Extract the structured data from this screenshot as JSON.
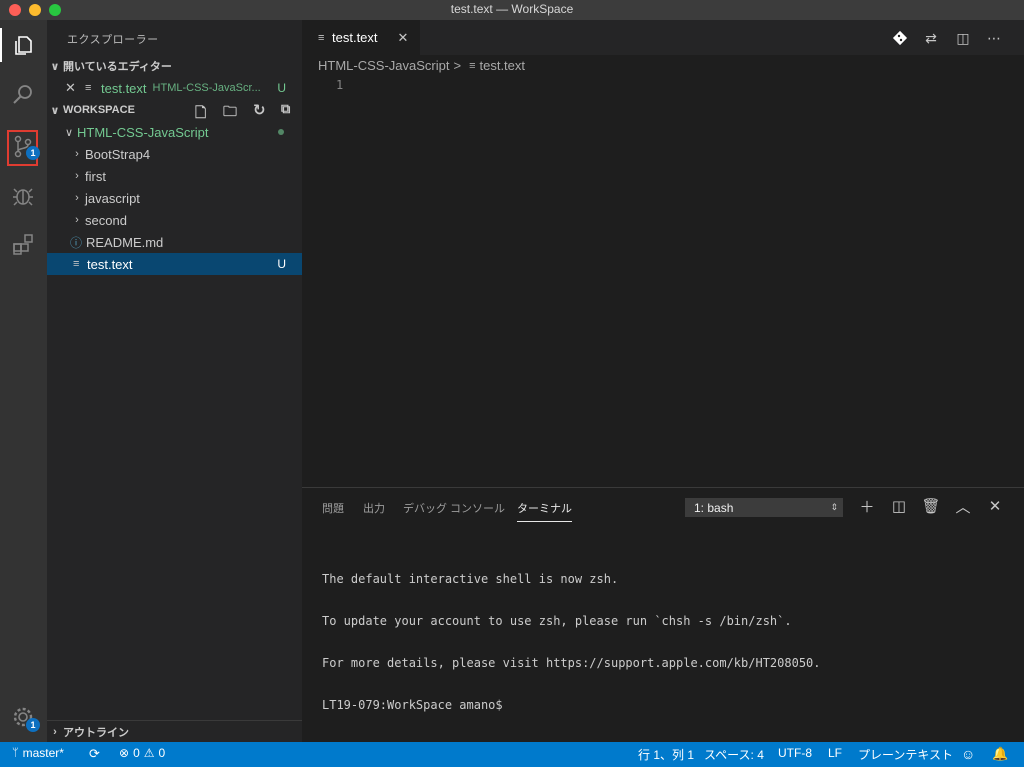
{
  "window": {
    "title": "test.text — WorkSpace"
  },
  "activity": {
    "scm_badge": "1",
    "settings_badge": "1"
  },
  "sidebar": {
    "title": "エクスプローラー",
    "open_editors": {
      "header": "開いているエディター",
      "item": {
        "name": "test.text",
        "path": "HTML-CSS-JavaScr...",
        "status": "U"
      }
    },
    "workspace": {
      "header": "WORKSPACE",
      "root": "HTML-CSS-JavaScript",
      "items": [
        {
          "name": "BootStrap4",
          "type": "folder"
        },
        {
          "name": "first",
          "type": "folder"
        },
        {
          "name": "javascript",
          "type": "folder"
        },
        {
          "name": "second",
          "type": "folder"
        },
        {
          "name": "README.md",
          "type": "info"
        },
        {
          "name": "test.text",
          "type": "text",
          "status": "U"
        }
      ]
    },
    "outline": {
      "header": "アウトライン"
    }
  },
  "editor": {
    "tab_label": "test.text",
    "breadcrumb": {
      "folder": "HTML-CSS-JavaScript",
      "sep": ">",
      "file": "test.text"
    },
    "line_number": "1"
  },
  "panel": {
    "tabs": [
      "問題",
      "出力",
      "デバッグ コンソール",
      "ターミナル"
    ],
    "terminal_select": "1: bash",
    "terminal_lines": [
      "The default interactive shell is now zsh.",
      "To update your account to use zsh, please run `chsh -s /bin/zsh`.",
      "For more details, please visit https://support.apple.com/kb/HT208050.",
      "LT19-079:WorkSpace amano$"
    ]
  },
  "status": {
    "branch": "master*",
    "errors": "0",
    "warnings": "0",
    "position": "行 1、列 1",
    "spaces": "スペース: 4",
    "encoding": "UTF-8",
    "eol": "LF",
    "language": "プレーンテキスト"
  },
  "colors": {
    "accent": "#007acc",
    "selection": "#094771",
    "untracked": "#73c991",
    "highlight_box": "#e03c31"
  }
}
